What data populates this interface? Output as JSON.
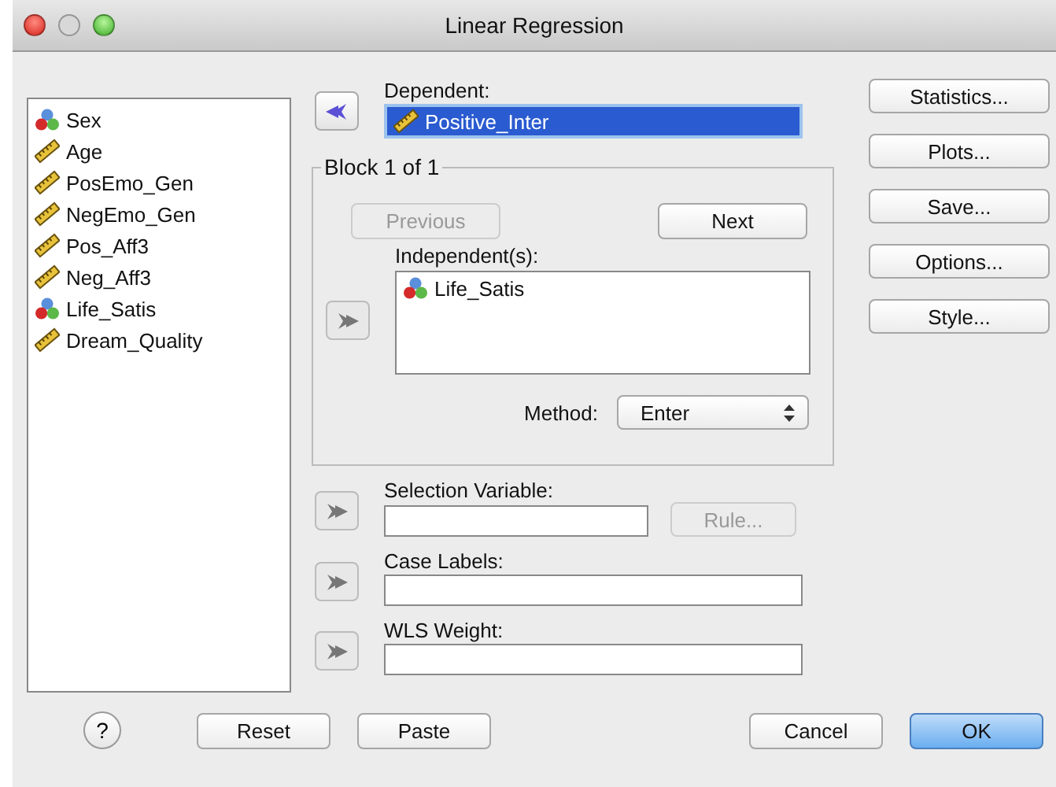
{
  "window": {
    "title": "Linear Regression"
  },
  "variables": [
    {
      "name": "Sex",
      "kind": "nominal"
    },
    {
      "name": "Age",
      "kind": "scale"
    },
    {
      "name": "PosEmo_Gen",
      "kind": "scale"
    },
    {
      "name": "NegEmo_Gen",
      "kind": "scale"
    },
    {
      "name": "Pos_Aff3",
      "kind": "scale"
    },
    {
      "name": "Neg_Aff3",
      "kind": "scale"
    },
    {
      "name": "Life_Satis",
      "kind": "nominal"
    },
    {
      "name": "Dream_Quality",
      "kind": "scale"
    }
  ],
  "dependent": {
    "label": "Dependent:",
    "arrow": {
      "points_left": true,
      "disabled": false
    },
    "items": [
      {
        "name": "Positive_Inter",
        "kind": "scale",
        "selected": true
      }
    ]
  },
  "block": {
    "title": "Block 1 of 1",
    "previous": {
      "label": "Previous",
      "disabled": true
    },
    "next": {
      "label": "Next",
      "disabled": false
    }
  },
  "independents": {
    "label": "Independent(s):",
    "arrow": {
      "points_left": false,
      "disabled": true
    },
    "items": [
      {
        "name": "Life_Satis",
        "kind": "nominal",
        "selected": false
      }
    ]
  },
  "method": {
    "label": "Method:",
    "value": "Enter"
  },
  "selection_variable": {
    "label": "Selection Variable:",
    "arrow": {
      "points_left": false,
      "disabled": true
    },
    "rule": {
      "label": "Rule...",
      "disabled": true
    }
  },
  "case_labels": {
    "label": "Case Labels:",
    "arrow": {
      "points_left": false,
      "disabled": true
    }
  },
  "wls_weight": {
    "label": "WLS Weight:",
    "arrow": {
      "points_left": false,
      "disabled": true
    }
  },
  "side_buttons": [
    "Statistics...",
    "Plots...",
    "Save...",
    "Options...",
    "Style..."
  ],
  "help": "?",
  "buttons": [
    {
      "label": "Reset",
      "default": false
    },
    {
      "label": "Paste",
      "default": false
    },
    {
      "label": "Cancel",
      "default": false
    },
    {
      "label": "OK",
      "default": true
    }
  ]
}
